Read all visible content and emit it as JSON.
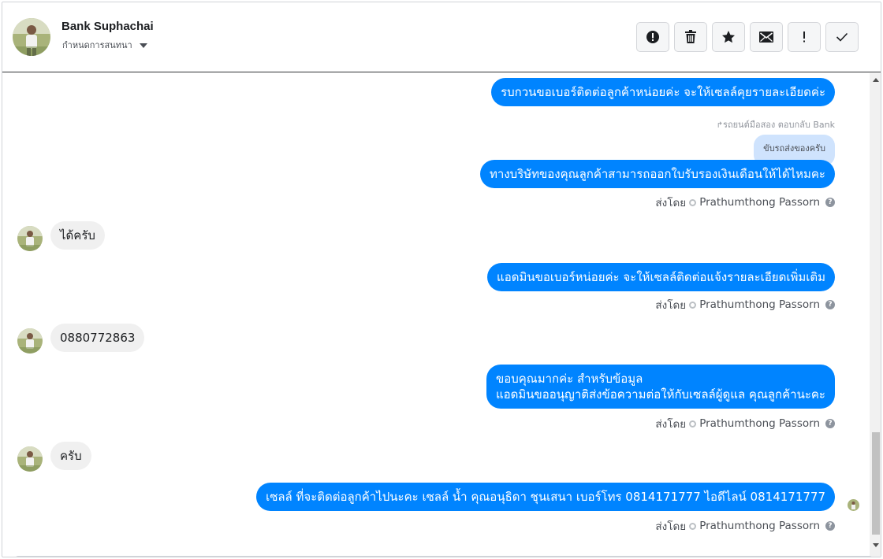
{
  "header": {
    "contact_name": "Bank Suphachai",
    "assign_label": "กำหนดการสนทนา",
    "assign_icon": "caret-down-icon",
    "actions": [
      {
        "name": "spam-button",
        "icon": "alert-circle-icon"
      },
      {
        "name": "delete-button",
        "icon": "trash-icon"
      },
      {
        "name": "star-button",
        "icon": "star-icon"
      },
      {
        "name": "mark-unread-button",
        "icon": "envelope-icon"
      },
      {
        "name": "follow-up-button",
        "icon": "exclamation-icon"
      },
      {
        "name": "mark-done-button",
        "icon": "check-icon"
      }
    ]
  },
  "messages": [
    {
      "direction": "out",
      "text": "รบกวนขอเบอร์ติดต่อลูกค้าหน่อยค่ะ จะให้เซลล์คุยรายละเอียดค่ะ"
    },
    {
      "reply_note": "รถยนต์มือสอง ตอบกลับ Bank",
      "quote": "ขับรถส่งของครับ"
    },
    {
      "direction": "out",
      "text": "ทางบริษัทของคุณลูกค้าสามารถออกใบรับรองเงินเดือนให้ได้ไหมคะ",
      "sent_by_label": "ส่งโดย",
      "sent_by_name": "Prathumthong Passorn"
    },
    {
      "direction": "in",
      "text": "ได้ครับ"
    },
    {
      "direction": "out",
      "text": "แอดมินขอเบอร์หน่อยค่ะ จะให้เซลล์ติดต่อแจ้งรายละเอียดเพิ่มเติม",
      "sent_by_label": "ส่งโดย",
      "sent_by_name": "Prathumthong Passorn"
    },
    {
      "direction": "in",
      "text": "0880772863"
    },
    {
      "direction": "out",
      "lines": [
        "ขอบคุณมากค่ะ สำหรับข้อมูล",
        "แอดมินขออนุญาติส่งข้อความต่อให้กับเซลล์ผู้ดูแล คุณลูกค้านะคะ"
      ],
      "sent_by_label": "ส่งโดย",
      "sent_by_name": "Prathumthong Passorn"
    },
    {
      "direction": "in",
      "text": "ครับ"
    },
    {
      "direction": "out",
      "text": "เซลล์ ที่จะติดต่อลูกค้าไปนะคะ เซลล์ น้ำ คุณอนุธิดา ชุนเสนา เบอร์โทร 0814171777 ไอดีไลน์ 0814171777",
      "sent_by_label": "ส่งโดย",
      "sent_by_name": "Prathumthong Passorn"
    }
  ],
  "colors": {
    "outgoing_bubble": "#0084ff",
    "incoming_bubble": "#f0f0f0",
    "quote_bubble": "#cfe3fd",
    "meta_text": "#4b4f56"
  }
}
